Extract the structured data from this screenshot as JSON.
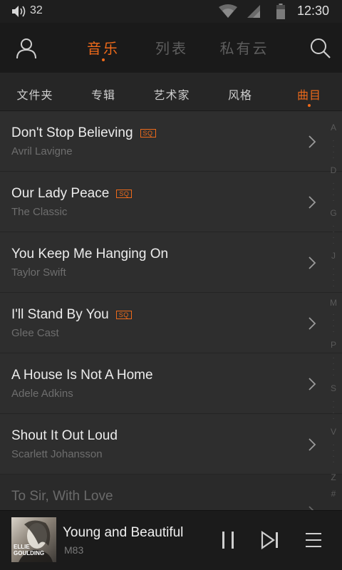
{
  "status_bar": {
    "volume": "32",
    "time": "12:30",
    "icons": [
      "volume-icon",
      "wifi-icon",
      "signal-icon",
      "battery-icon"
    ]
  },
  "top_nav": {
    "tabs": [
      {
        "label": "音乐",
        "active": true
      },
      {
        "label": "列表",
        "active": false
      },
      {
        "label": "私有云",
        "active": false
      }
    ],
    "icons": [
      "user-icon",
      "search-icon"
    ]
  },
  "categories": [
    {
      "label": "文件夹",
      "active": false
    },
    {
      "label": "专辑",
      "active": false
    },
    {
      "label": "艺术家",
      "active": false
    },
    {
      "label": "风格",
      "active": false
    },
    {
      "label": "曲目",
      "active": true
    }
  ],
  "songs": [
    {
      "title": "Don't Stop Believing",
      "artist": "Avril Lavigne",
      "sq": true
    },
    {
      "title": "Our Lady Peace",
      "artist": "The Classic",
      "sq": true
    },
    {
      "title": "You Keep Me Hanging On",
      "artist": "Taylor Swift",
      "sq": false
    },
    {
      "title": "I'll Stand By You",
      "artist": "Glee Cast",
      "sq": true
    },
    {
      "title": "A House Is Not A Home",
      "artist": "Adele Adkins",
      "sq": false
    },
    {
      "title": "Shout It Out Loud",
      "artist": "Scarlett Johansson",
      "sq": false
    },
    {
      "title": "To Sir, With Love",
      "artist": "",
      "sq": false
    }
  ],
  "sq_label": "SQ",
  "index_letters": [
    "A",
    "D",
    "G",
    "J",
    "M",
    "P",
    "S",
    "V",
    "Z",
    "#"
  ],
  "now_playing": {
    "title": "Young and Beautiful",
    "artist": "M83",
    "album_art_text": "ELLIE GOULDING"
  },
  "colors": {
    "accent": "#ee6a1a",
    "background": "#2c2c2c",
    "nav_background": "#1a1a1a",
    "player_background": "#1b1b1b"
  }
}
